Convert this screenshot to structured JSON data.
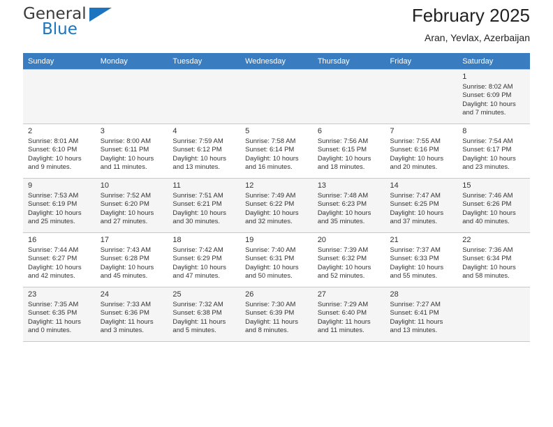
{
  "brand": {
    "name_top": "General",
    "name_bottom": "Blue",
    "accent_color": "#1b74c0",
    "triangle_icon": "triangle-icon"
  },
  "header": {
    "title": "February 2025",
    "subtitle": "Aran, Yevlax, Azerbaijan"
  },
  "calendar": {
    "header_bg": "#3a7cc0",
    "weekday_headers": [
      "Sunday",
      "Monday",
      "Tuesday",
      "Wednesday",
      "Thursday",
      "Friday",
      "Saturday"
    ],
    "weeks": [
      [
        {
          "day": "",
          "sunrise": "",
          "sunset": "",
          "daylight_1": "",
          "daylight_2": ""
        },
        {
          "day": "",
          "sunrise": "",
          "sunset": "",
          "daylight_1": "",
          "daylight_2": ""
        },
        {
          "day": "",
          "sunrise": "",
          "sunset": "",
          "daylight_1": "",
          "daylight_2": ""
        },
        {
          "day": "",
          "sunrise": "",
          "sunset": "",
          "daylight_1": "",
          "daylight_2": ""
        },
        {
          "day": "",
          "sunrise": "",
          "sunset": "",
          "daylight_1": "",
          "daylight_2": ""
        },
        {
          "day": "",
          "sunrise": "",
          "sunset": "",
          "daylight_1": "",
          "daylight_2": ""
        },
        {
          "day": "1",
          "sunrise": "Sunrise: 8:02 AM",
          "sunset": "Sunset: 6:09 PM",
          "daylight_1": "Daylight: 10 hours",
          "daylight_2": "and 7 minutes."
        }
      ],
      [
        {
          "day": "2",
          "sunrise": "Sunrise: 8:01 AM",
          "sunset": "Sunset: 6:10 PM",
          "daylight_1": "Daylight: 10 hours",
          "daylight_2": "and 9 minutes."
        },
        {
          "day": "3",
          "sunrise": "Sunrise: 8:00 AM",
          "sunset": "Sunset: 6:11 PM",
          "daylight_1": "Daylight: 10 hours",
          "daylight_2": "and 11 minutes."
        },
        {
          "day": "4",
          "sunrise": "Sunrise: 7:59 AM",
          "sunset": "Sunset: 6:12 PM",
          "daylight_1": "Daylight: 10 hours",
          "daylight_2": "and 13 minutes."
        },
        {
          "day": "5",
          "sunrise": "Sunrise: 7:58 AM",
          "sunset": "Sunset: 6:14 PM",
          "daylight_1": "Daylight: 10 hours",
          "daylight_2": "and 16 minutes."
        },
        {
          "day": "6",
          "sunrise": "Sunrise: 7:56 AM",
          "sunset": "Sunset: 6:15 PM",
          "daylight_1": "Daylight: 10 hours",
          "daylight_2": "and 18 minutes."
        },
        {
          "day": "7",
          "sunrise": "Sunrise: 7:55 AM",
          "sunset": "Sunset: 6:16 PM",
          "daylight_1": "Daylight: 10 hours",
          "daylight_2": "and 20 minutes."
        },
        {
          "day": "8",
          "sunrise": "Sunrise: 7:54 AM",
          "sunset": "Sunset: 6:17 PM",
          "daylight_1": "Daylight: 10 hours",
          "daylight_2": "and 23 minutes."
        }
      ],
      [
        {
          "day": "9",
          "sunrise": "Sunrise: 7:53 AM",
          "sunset": "Sunset: 6:19 PM",
          "daylight_1": "Daylight: 10 hours",
          "daylight_2": "and 25 minutes."
        },
        {
          "day": "10",
          "sunrise": "Sunrise: 7:52 AM",
          "sunset": "Sunset: 6:20 PM",
          "daylight_1": "Daylight: 10 hours",
          "daylight_2": "and 27 minutes."
        },
        {
          "day": "11",
          "sunrise": "Sunrise: 7:51 AM",
          "sunset": "Sunset: 6:21 PM",
          "daylight_1": "Daylight: 10 hours",
          "daylight_2": "and 30 minutes."
        },
        {
          "day": "12",
          "sunrise": "Sunrise: 7:49 AM",
          "sunset": "Sunset: 6:22 PM",
          "daylight_1": "Daylight: 10 hours",
          "daylight_2": "and 32 minutes."
        },
        {
          "day": "13",
          "sunrise": "Sunrise: 7:48 AM",
          "sunset": "Sunset: 6:23 PM",
          "daylight_1": "Daylight: 10 hours",
          "daylight_2": "and 35 minutes."
        },
        {
          "day": "14",
          "sunrise": "Sunrise: 7:47 AM",
          "sunset": "Sunset: 6:25 PM",
          "daylight_1": "Daylight: 10 hours",
          "daylight_2": "and 37 minutes."
        },
        {
          "day": "15",
          "sunrise": "Sunrise: 7:46 AM",
          "sunset": "Sunset: 6:26 PM",
          "daylight_1": "Daylight: 10 hours",
          "daylight_2": "and 40 minutes."
        }
      ],
      [
        {
          "day": "16",
          "sunrise": "Sunrise: 7:44 AM",
          "sunset": "Sunset: 6:27 PM",
          "daylight_1": "Daylight: 10 hours",
          "daylight_2": "and 42 minutes."
        },
        {
          "day": "17",
          "sunrise": "Sunrise: 7:43 AM",
          "sunset": "Sunset: 6:28 PM",
          "daylight_1": "Daylight: 10 hours",
          "daylight_2": "and 45 minutes."
        },
        {
          "day": "18",
          "sunrise": "Sunrise: 7:42 AM",
          "sunset": "Sunset: 6:29 PM",
          "daylight_1": "Daylight: 10 hours",
          "daylight_2": "and 47 minutes."
        },
        {
          "day": "19",
          "sunrise": "Sunrise: 7:40 AM",
          "sunset": "Sunset: 6:31 PM",
          "daylight_1": "Daylight: 10 hours",
          "daylight_2": "and 50 minutes."
        },
        {
          "day": "20",
          "sunrise": "Sunrise: 7:39 AM",
          "sunset": "Sunset: 6:32 PM",
          "daylight_1": "Daylight: 10 hours",
          "daylight_2": "and 52 minutes."
        },
        {
          "day": "21",
          "sunrise": "Sunrise: 7:37 AM",
          "sunset": "Sunset: 6:33 PM",
          "daylight_1": "Daylight: 10 hours",
          "daylight_2": "and 55 minutes."
        },
        {
          "day": "22",
          "sunrise": "Sunrise: 7:36 AM",
          "sunset": "Sunset: 6:34 PM",
          "daylight_1": "Daylight: 10 hours",
          "daylight_2": "and 58 minutes."
        }
      ],
      [
        {
          "day": "23",
          "sunrise": "Sunrise: 7:35 AM",
          "sunset": "Sunset: 6:35 PM",
          "daylight_1": "Daylight: 11 hours",
          "daylight_2": "and 0 minutes."
        },
        {
          "day": "24",
          "sunrise": "Sunrise: 7:33 AM",
          "sunset": "Sunset: 6:36 PM",
          "daylight_1": "Daylight: 11 hours",
          "daylight_2": "and 3 minutes."
        },
        {
          "day": "25",
          "sunrise": "Sunrise: 7:32 AM",
          "sunset": "Sunset: 6:38 PM",
          "daylight_1": "Daylight: 11 hours",
          "daylight_2": "and 5 minutes."
        },
        {
          "day": "26",
          "sunrise": "Sunrise: 7:30 AM",
          "sunset": "Sunset: 6:39 PM",
          "daylight_1": "Daylight: 11 hours",
          "daylight_2": "and 8 minutes."
        },
        {
          "day": "27",
          "sunrise": "Sunrise: 7:29 AM",
          "sunset": "Sunset: 6:40 PM",
          "daylight_1": "Daylight: 11 hours",
          "daylight_2": "and 11 minutes."
        },
        {
          "day": "28",
          "sunrise": "Sunrise: 7:27 AM",
          "sunset": "Sunset: 6:41 PM",
          "daylight_1": "Daylight: 11 hours",
          "daylight_2": "and 13 minutes."
        },
        {
          "day": "",
          "sunrise": "",
          "sunset": "",
          "daylight_1": "",
          "daylight_2": ""
        }
      ]
    ]
  }
}
